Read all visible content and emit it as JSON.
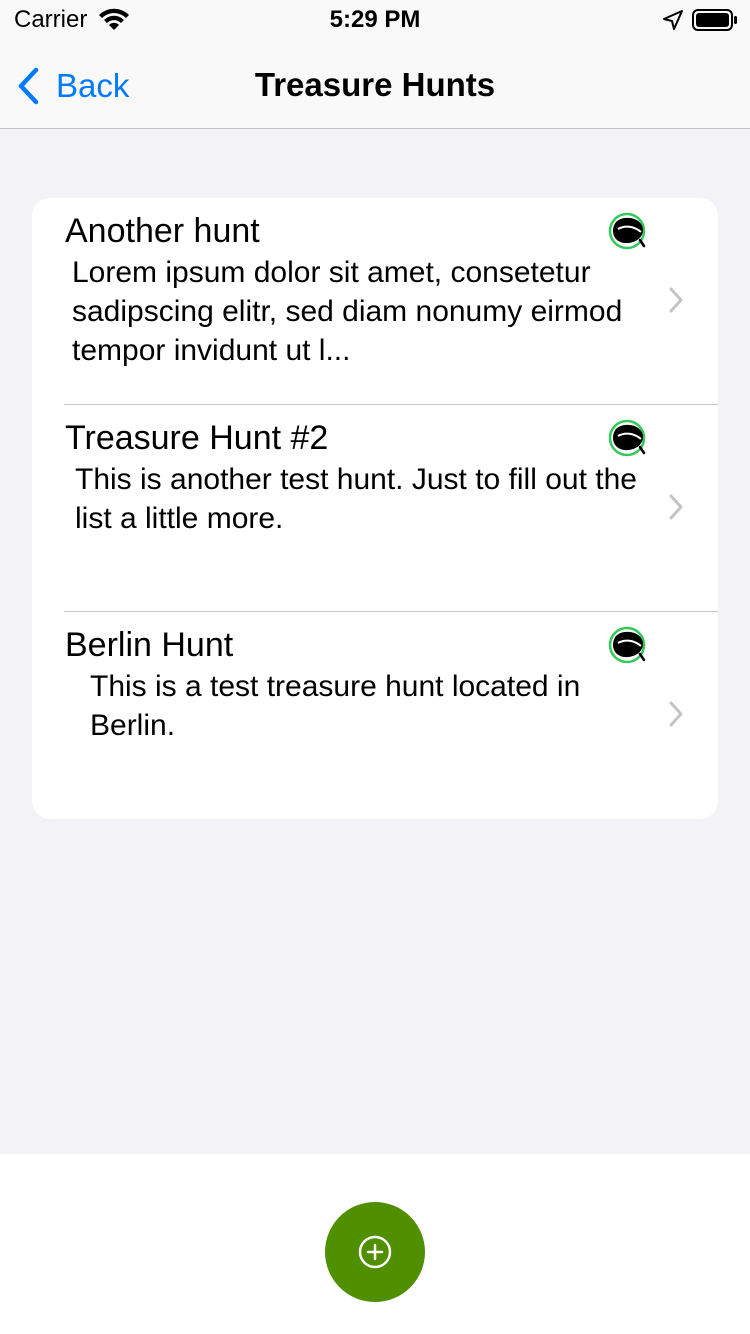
{
  "status_bar": {
    "carrier": "Carrier",
    "time": "5:29 PM"
  },
  "nav": {
    "back_label": "Back",
    "title": "Treasure Hunts",
    "accent": "#007aff"
  },
  "hunts": [
    {
      "title": "Another hunt",
      "description": "Lorem ipsum dolor sit amet, consetetur sadipscing elitr, sed diam nonumy eirmod tempor invidunt ut l...",
      "icon": "leaf-icon"
    },
    {
      "title": "Treasure Hunt #2",
      "description": "This is another test hunt. Just to fill out the list a little more.",
      "icon": "leaf-icon"
    },
    {
      "title": "Berlin Hunt",
      "description": "This is a test treasure hunt located in Berlin.",
      "icon": "leaf-icon"
    }
  ],
  "fab": {
    "icon": "plus-circle-icon",
    "color": "#4f8f00"
  }
}
